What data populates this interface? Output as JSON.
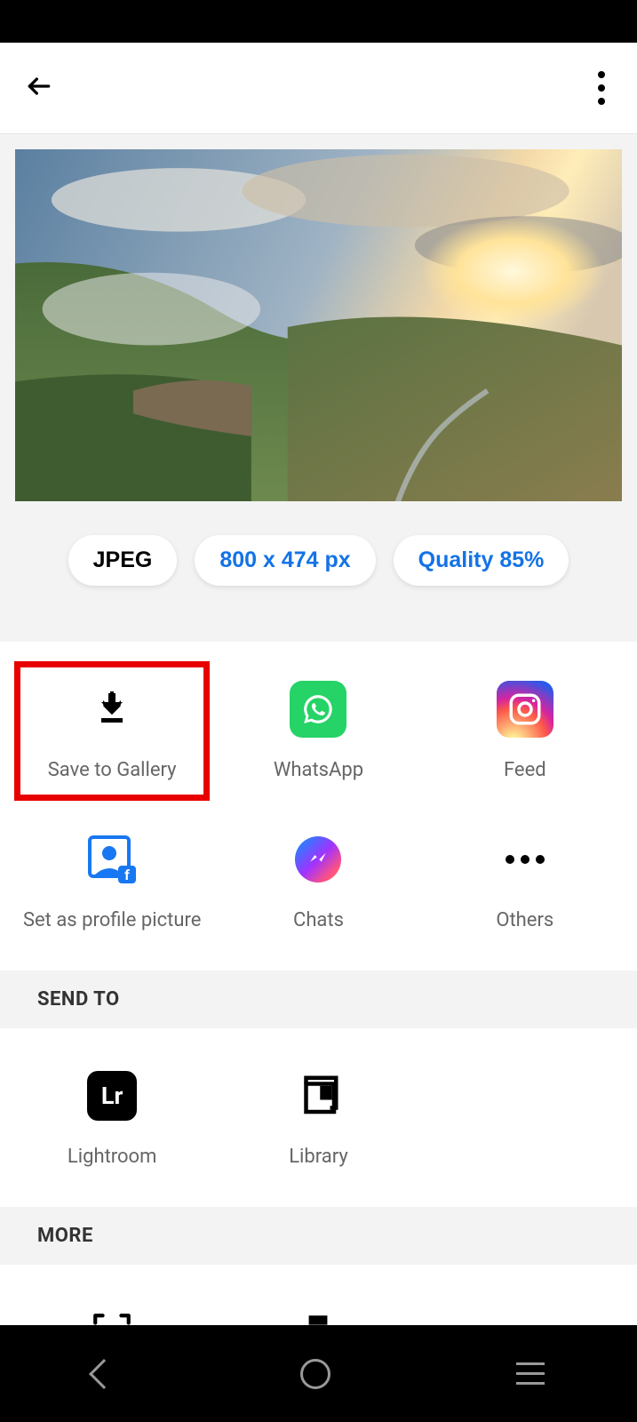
{
  "export": {
    "format_label": "JPEG",
    "dimensions_label": "800 x 474 px",
    "quality_label": "Quality 85%"
  },
  "share": {
    "row1": [
      {
        "label": "Save to Gallery"
      },
      {
        "label": "WhatsApp"
      },
      {
        "label": "Feed"
      }
    ],
    "row2": [
      {
        "label": "Set as profile picture"
      },
      {
        "label": "Chats"
      },
      {
        "label": "Others"
      }
    ]
  },
  "sections": {
    "send_to": "SEND TO",
    "more": "MORE"
  },
  "send_to": {
    "items": [
      {
        "label": "Lightroom",
        "icon_text": "Lr"
      },
      {
        "label": "Library"
      }
    ]
  },
  "more_row": {
    "items": [
      {
        "label": ""
      },
      {
        "label": ""
      },
      {
        "label": ""
      }
    ]
  }
}
